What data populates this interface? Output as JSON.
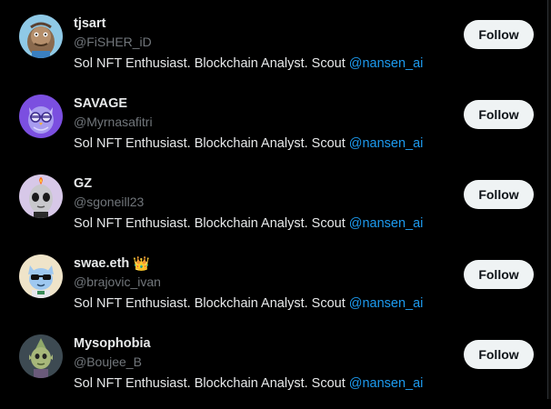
{
  "users": [
    {
      "name": "tjsart",
      "handle": "@FiSHER_iD",
      "bio_text": "Sol NFT Enthusiast. Blockchain Analyst. Scout ",
      "bio_mention": "@nansen_ai",
      "follow_label": "Follow",
      "avatar_icon": "ape-avatar-icon",
      "badge": ""
    },
    {
      "name": "SAVAGE",
      "handle": "@Myrnasafitri",
      "bio_text": "Sol NFT Enthusiast. Blockchain Analyst. Scout ",
      "bio_mention": "@nansen_ai",
      "follow_label": "Follow",
      "avatar_icon": "owl-avatar-icon",
      "badge": ""
    },
    {
      "name": "GZ",
      "handle": "@sgoneill23",
      "bio_text": "Sol NFT Enthusiast. Blockchain Analyst. Scout ",
      "bio_mention": "@nansen_ai",
      "follow_label": "Follow",
      "avatar_icon": "alien-avatar-icon",
      "badge": ""
    },
    {
      "name": "swae.eth",
      "handle": "@brajovic_ivan",
      "bio_text": "Sol NFT Enthusiast. Blockchain Analyst. Scout ",
      "bio_mention": "@nansen_ai",
      "follow_label": "Follow",
      "avatar_icon": "cat-sunglasses-avatar-icon",
      "badge": "👑"
    },
    {
      "name": "Mysophobia",
      "handle": "@Boujee_B",
      "bio_text": "Sol NFT Enthusiast. Blockchain Analyst. Scout ",
      "bio_mention": "@nansen_ai",
      "follow_label": "Follow",
      "avatar_icon": "goblin-avatar-icon",
      "badge": ""
    }
  ],
  "colors": {
    "background": "#000000",
    "name": "#e7e9ea",
    "handle": "#71767b",
    "mention": "#1d9bf0",
    "follow_bg": "#eff3f4",
    "follow_text": "#0f1419"
  }
}
